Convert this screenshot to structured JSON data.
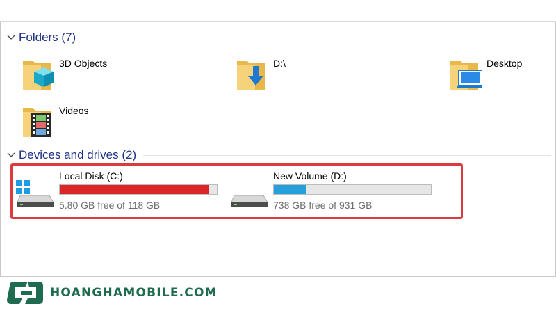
{
  "folders_group": {
    "title": "Folders (7)",
    "items": [
      {
        "label": "3D Objects",
        "icon": "3d-objects-folder-icon"
      },
      {
        "label": "D:\\",
        "icon": "downloads-folder-icon"
      },
      {
        "label": "Desktop",
        "icon": "desktop-folder-icon"
      },
      {
        "label": "Videos",
        "icon": "videos-folder-icon"
      }
    ]
  },
  "drives_group": {
    "title": "Devices and drives (2)",
    "drives": [
      {
        "name": "Local Disk (C:)",
        "free_text": "5.80 GB free of 118 GB",
        "used_fraction": 0.95,
        "bar_color": "#da2626",
        "icon": "windows-drive-icon"
      },
      {
        "name": "New Volume (D:)",
        "free_text": "738 GB free of 931 GB",
        "used_fraction": 0.21,
        "bar_color": "#26a0da",
        "icon": "hard-drive-icon"
      }
    ]
  },
  "colors": {
    "group_title": "#1e3287",
    "highlight_border": "#d93b3f",
    "brand": "#1f6b4f"
  },
  "brand": {
    "text": "HOANGHAMOBILE.COM"
  }
}
